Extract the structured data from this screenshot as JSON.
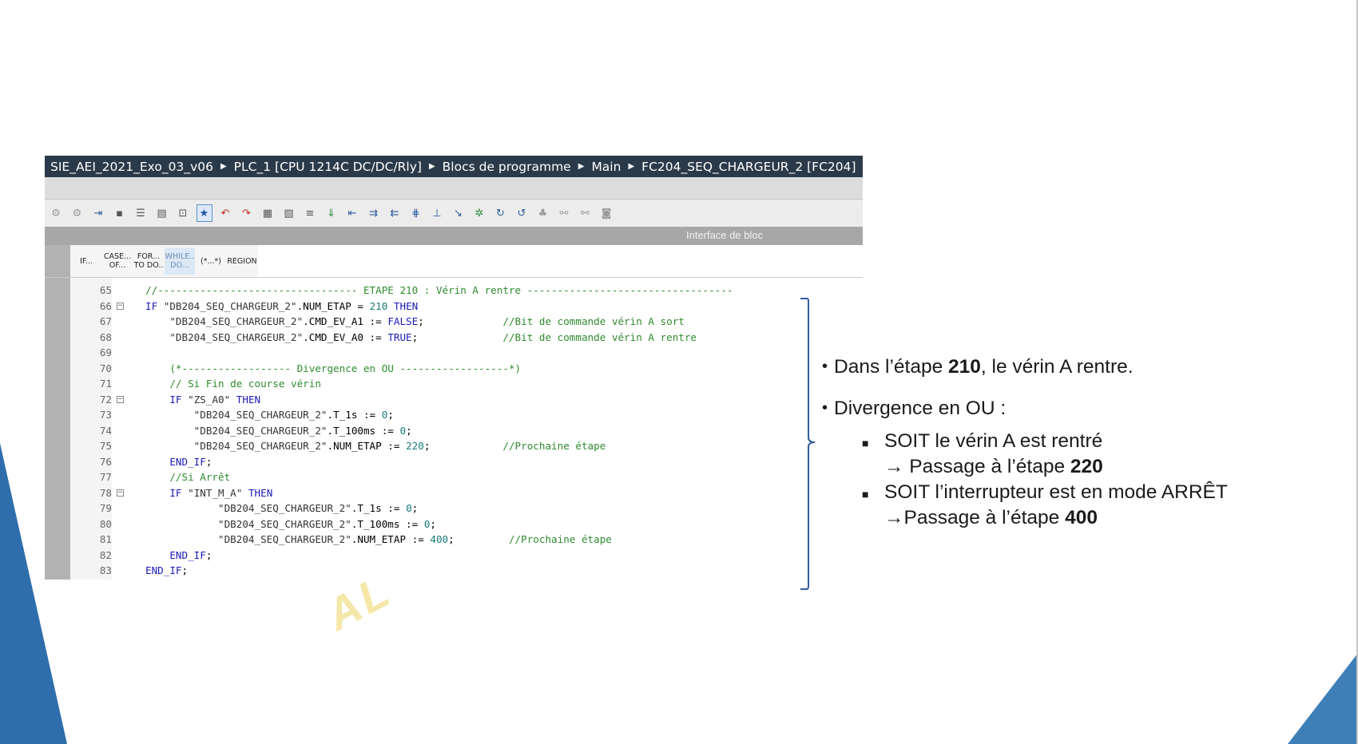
{
  "breadcrumb": [
    "SIE_AEI_2021_Exo_03_v06",
    "PLC_1 [CPU 1214C DC/DC/Rly]",
    "Blocs de programme",
    "Main",
    "FC204_SEQ_CHARGEUR_2 [FC204]"
  ],
  "toolbar": {
    "icons": [
      "compile-icon",
      "download-icon",
      "insert-network-icon",
      "go-online-icon",
      "monitor-icon",
      "list-icon",
      "block-icon",
      "snapshot-icon",
      "favorites-icon",
      "undo-red-icon",
      "redo-red-icon",
      "comment-out-icon",
      "uncomment-icon",
      "indent-icon",
      "download-arrow-icon",
      "outdent-icon",
      "increase-indent-icon",
      "decrease-indent-icon",
      "format-icon",
      "breakpoint-icon",
      "step-icon",
      "step-over-icon",
      "snowflake-icon",
      "refresh-icon",
      "jump-icon",
      "tree-icon",
      "compare-icon",
      "compare2-icon",
      "database-icon"
    ],
    "interface_label": "Interface de bloc"
  },
  "instruction_bar": [
    {
      "label": "IF...",
      "selected": false
    },
    {
      "label": "CASE...\nOF...",
      "selected": false
    },
    {
      "label": "FOR...\nTO DO..",
      "selected": false
    },
    {
      "label": "WHILE..\nDO...",
      "selected": true
    },
    {
      "label": "(*...*)",
      "selected": false
    },
    {
      "label": "REGION",
      "selected": false
    }
  ],
  "code": {
    "lines": [
      {
        "n": "65",
        "fold": false,
        "text": "//--------------------------------- ETAPE 210 : Vérin A rentre ----------------------------------"
      },
      {
        "n": "66",
        "fold": true,
        "text": "IF \"DB204_SEQ_CHARGEUR_2\".NUM_ETAP = 210 THEN"
      },
      {
        "n": "67",
        "fold": false,
        "text": "    \"DB204_SEQ_CHARGEUR_2\".CMD_EV_A1 := FALSE;             //Bit de commande vérin A sort"
      },
      {
        "n": "68",
        "fold": false,
        "text": "    \"DB204_SEQ_CHARGEUR_2\".CMD_EV_A0 := TRUE;              //Bit de commande vérin A rentre"
      },
      {
        "n": "69",
        "fold": false,
        "text": ""
      },
      {
        "n": "70",
        "fold": false,
        "text": "    (*------------------ Divergence en OU ------------------*)"
      },
      {
        "n": "71",
        "fold": false,
        "text": "    // Si Fin de course vérin"
      },
      {
        "n": "72",
        "fold": true,
        "text": "    IF \"ZS_A0\" THEN"
      },
      {
        "n": "73",
        "fold": false,
        "text": "        \"DB204_SEQ_CHARGEUR_2\".T_1s := 0;"
      },
      {
        "n": "74",
        "fold": false,
        "text": "        \"DB204_SEQ_CHARGEUR_2\".T_100ms := 0;"
      },
      {
        "n": "75",
        "fold": false,
        "text": "        \"DB204_SEQ_CHARGEUR_2\".NUM_ETAP := 220;            //Prochaine étape"
      },
      {
        "n": "76",
        "fold": false,
        "text": "    END_IF;"
      },
      {
        "n": "77",
        "fold": false,
        "text": "    //Si Arrêt"
      },
      {
        "n": "78",
        "fold": true,
        "text": "    IF \"INT_M_A\" THEN"
      },
      {
        "n": "79",
        "fold": false,
        "text": "            \"DB204_SEQ_CHARGEUR_2\".T_1s := 0;"
      },
      {
        "n": "80",
        "fold": false,
        "text": "            \"DB204_SEQ_CHARGEUR_2\".T_100ms := 0;"
      },
      {
        "n": "81",
        "fold": false,
        "text": "            \"DB204_SEQ_CHARGEUR_2\".NUM_ETAP := 400;         //Prochaine étape"
      },
      {
        "n": "82",
        "fold": false,
        "text": "    END_IF;"
      },
      {
        "n": "83",
        "fold": false,
        "text": "END_IF;"
      }
    ]
  },
  "watermark": "AL",
  "explanation": {
    "bullet1": {
      "prefix": "Dans l’étape ",
      "value": "210",
      "suffix": ", le vérin A rentre."
    },
    "bullet2": "Divergence en OU :",
    "sub1": {
      "line1": "SOIT le vérin A est rentré",
      "line2_prefix": "→ Passage à l’étape ",
      "line2_value": "220"
    },
    "sub2": {
      "line1": "SOIT l’interrupteur est en mode ARRÊT",
      "line2_prefix": "→Passage à l’étape ",
      "line2_value": "400"
    }
  },
  "colors": {
    "accent_blue": "#2f6eac",
    "breadcrumb_bg": "#2b3a4a",
    "keyword": "#1a1ab8",
    "comment": "#2e8b2e"
  }
}
